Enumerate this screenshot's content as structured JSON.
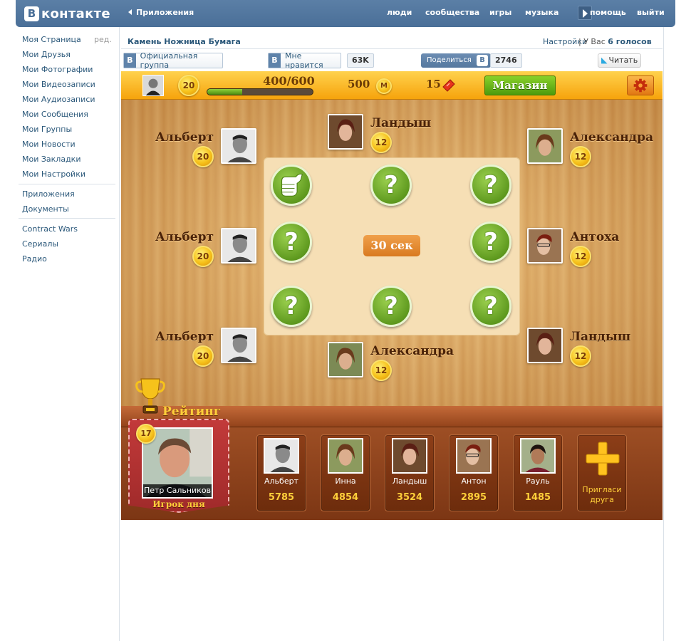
{
  "header": {
    "logo_letter": "В",
    "logo_text": "контакте",
    "crumb": "Приложения",
    "nav": [
      "люди",
      "сообщества",
      "игры",
      "музыка",
      "помощь",
      "выйти"
    ]
  },
  "sidebar": {
    "edit": "ред.",
    "group1": [
      "Моя Страница",
      "Мои Друзья",
      "Мои Фотографии",
      "Мои Видеозаписи",
      "Мои Аудиозаписи",
      "Мои Сообщения",
      "Мои Группы",
      "Мои Новости",
      "Мои Закладки",
      "Мои Настройки"
    ],
    "group2": [
      "Приложения",
      "Документы"
    ],
    "group3": [
      "Contract Wars",
      "Сериалы",
      "Радио"
    ]
  },
  "app": {
    "title": "Камень Ножница Бумага",
    "settings": "Настройки",
    "votes_prefix": "| У Вас",
    "votes_value": "6 голосов",
    "official_group": "Официальная группа",
    "like": "Мне нравится",
    "like_count": "63K",
    "share": "Поделиться",
    "share_count": "2746",
    "tweet": "Читать",
    "vk_letter": "В"
  },
  "game": {
    "level": "20",
    "xp": "400/600",
    "xp_fraction": 0.333,
    "money": "500",
    "money_icon_letter": "М",
    "tickets": "15",
    "shop": "Магазин",
    "timer": "30 сек",
    "players_left": [
      {
        "name": "Альберт",
        "level": "20"
      },
      {
        "name": "Альберт",
        "level": "20"
      },
      {
        "name": "Альберт",
        "level": "20"
      }
    ],
    "player_top": {
      "name": "Ландыш",
      "level": "12"
    },
    "player_bottom": {
      "name": "Александра",
      "level": "12"
    },
    "players_right": [
      {
        "name": "Александра",
        "level": "12"
      },
      {
        "name": "Антоха",
        "level": "12"
      },
      {
        "name": "Ландыш",
        "level": "12"
      }
    ]
  },
  "rating": {
    "title": "Рейтинг",
    "potd_rank": "17",
    "potd_name": "Петр Сальников",
    "potd_caption": "Игрок дня",
    "entries": [
      {
        "name": "Альберт",
        "score": "5785"
      },
      {
        "name": "Инна",
        "score": "4854"
      },
      {
        "name": "Ландыш",
        "score": "3524"
      },
      {
        "name": "Антон",
        "score": "2895"
      },
      {
        "name": "Рауль",
        "score": "1485"
      }
    ],
    "invite_line1": "Пригласи",
    "invite_line2": "друга"
  }
}
